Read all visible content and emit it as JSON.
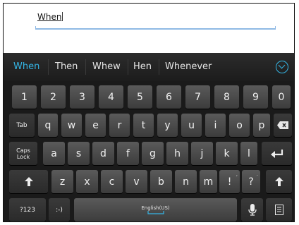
{
  "text_field": {
    "value": "When"
  },
  "suggestions": [
    "When",
    "Then",
    "Whew",
    "Hen",
    "Whenever"
  ],
  "keys": {
    "row_numbers": [
      "1",
      "2",
      "3",
      "4",
      "5",
      "6",
      "7",
      "8",
      "9",
      "0"
    ],
    "row_qwerty": [
      "q",
      "w",
      "e",
      "r",
      "t",
      "y",
      "u",
      "i",
      "o",
      "p"
    ],
    "row_home": [
      "a",
      "s",
      "d",
      "f",
      "g",
      "h",
      "j",
      "k",
      "l"
    ],
    "row_bottom_letters": [
      "z",
      "x",
      "c",
      "v",
      "b",
      "n",
      "m"
    ],
    "tab_label": "Tab",
    "caps_label_1": "Caps",
    "caps_label_2": "Lock",
    "excl_label": "!",
    "excl_hint": ",",
    "question_label": "?",
    "question_hint": ".",
    "symbols_label": "?123",
    "emoticon_label": ":-)",
    "space_label": "English(US)"
  },
  "colors": {
    "accent": "#34b5e5"
  }
}
